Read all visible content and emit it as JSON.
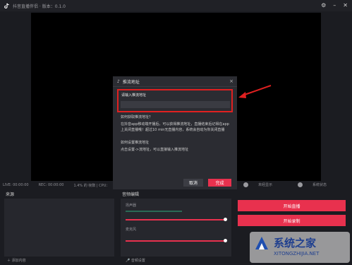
{
  "app": {
    "title": "抖音直播伴侣 · 版本：0.1.0"
  },
  "status_bar": {
    "live": "LIVE: 00:00:00",
    "rec": "REC: 00:00:00",
    "cpu": "1.4% 的 帧数 | CPU：",
    "opt1": "未经显示",
    "opt2": "系统状态"
  },
  "panels": {
    "source_title": "来源",
    "mixer_title": "音频编辑",
    "add_source": "添加内容",
    "audio_settings": "音频设置"
  },
  "mixer": {
    "speaker_label": "扬声器",
    "mic_label": "麦克风",
    "speaker_level": 0.55,
    "mic_level": 0.0
  },
  "buttons": {
    "start_live": "开始直播",
    "start_record": "开始录制"
  },
  "dialog": {
    "title": "推流地址",
    "input_label": "请输入推流地址",
    "input_value": "",
    "q1": "如何获取推流地址？",
    "a1": "在抖音app移动端开播后，可以获得推流地址，直播结束后记得在app上关闭直播哦！超过10 min无直播内容，系统会自动为你关闭直播",
    "q2": "如何设置推流地址",
    "a2": "点击设置->流地址，可以直接输入推流地址",
    "cancel": "取消",
    "ok": "完成"
  },
  "colors": {
    "accent": "#e8314e",
    "annotation": "#e02020"
  }
}
